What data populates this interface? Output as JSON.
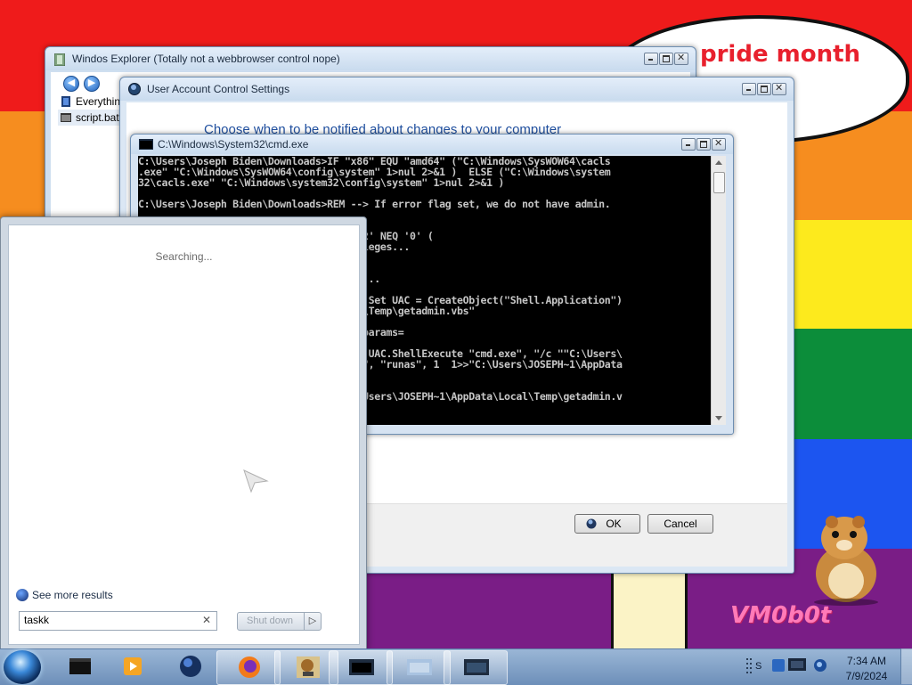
{
  "wallpaper": {
    "stripe_colors": [
      "#ef1b1b",
      "#f68d1f",
      "#fdea1d",
      "#0c8d3a",
      "#1c55f0",
      "#7a1d86"
    ],
    "bubble_text": "y pride month",
    "brand_text": "VM0b0t"
  },
  "explorer": {
    "title": "Windos Explorer (Totally not a webbrowser control nope)",
    "items": [
      "Everythin",
      "script.bat"
    ]
  },
  "uac": {
    "title": "User Account Control Settings",
    "heading": "Choose when to be notified about changes to your computer",
    "ok_label": "OK",
    "cancel_label": "Cancel"
  },
  "cmd": {
    "title": "C:\\Windows\\System32\\cmd.exe",
    "lines": [
      "C:\\Users\\Joseph Biden\\Downloads>IF \"x86\" EQU \"amd64\" (\"C:\\Windows\\SysWOW64\\cacls",
      ".exe\" \"C:\\Windows\\SysWOW64\\config\\system\" 1>nul 2>&1 )  ELSE (\"C:\\Windows\\system",
      "32\\cacls.exe\" \"C:\\Windows\\system32\\config\\system\" 1>nul 2>&1 )",
      "",
      "C:\\Users\\Joseph Biden\\Downloads>REM --> If error flag set, we do not have admin.",
      "",
      "",
      "                                  if '2' NEQ '0' (",
      "                                  rivileges...",
      "",
      "",
      "                                  eges...",
      "",
      "                                  echo Set UAC = CreateObject(\"Shell.Application\")",
      "                                  ocal\\Temp\\getadmin.vbs\"",
      "",
      "                                  set params=",
      "",
      "                                  echo UAC.ShellExecute \"cmd.exe\", \"/c \"\"C:\\Users\\",
      "                                  \", \"\", \"runas\", 1  1>>\"C:\\Users\\JOSEPH~1\\AppData",
      "",
      "",
      "                                  \"C:\\Users\\JOSEPH~1\\AppData\\Local\\Temp\\getadmin.v"
    ]
  },
  "startmenu": {
    "status": "Searching...",
    "see_more": "See more results",
    "search_value": "taskk",
    "shutdown_label": "Shut down"
  },
  "taskbar": {
    "time": "7:34 AM",
    "date": "7/9/2024",
    "tray_fragment": "S",
    "pinned": [
      "cmd",
      "media-player",
      "globe",
      "firefox",
      "virtualbox",
      "cmd-window",
      "uac-window",
      "explorer-window"
    ]
  }
}
